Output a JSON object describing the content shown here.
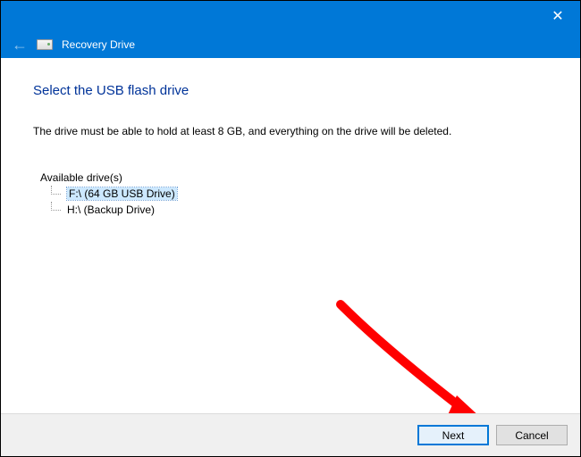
{
  "titlebar": {
    "close_label": "✕"
  },
  "header": {
    "title": "Recovery Drive"
  },
  "main": {
    "heading": "Select the USB flash drive",
    "description": "The drive must be able to hold at least 8 GB, and everything on the drive will be deleted.",
    "available_label": "Available drive(s)",
    "drives": [
      {
        "label": "F:\\ (64 GB USB Drive)",
        "selected": true
      },
      {
        "label": "H:\\ (Backup Drive)",
        "selected": false
      }
    ]
  },
  "footer": {
    "next_label": "Next",
    "cancel_label": "Cancel"
  }
}
